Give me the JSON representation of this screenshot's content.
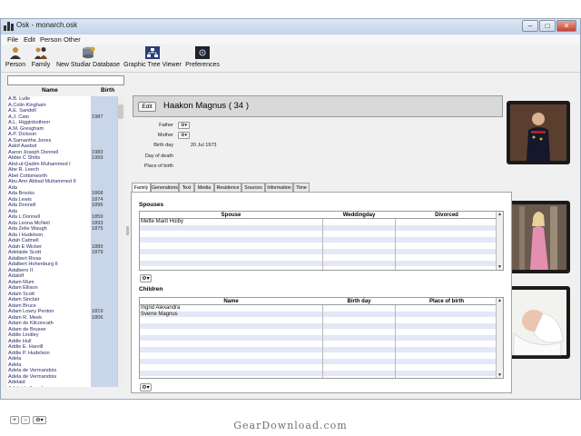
{
  "window": {
    "title": "Osk - monarch.osk"
  },
  "menu": [
    "File",
    "Edit",
    "Person",
    "Other"
  ],
  "toolbar": {
    "person": "Person",
    "family": "Family",
    "new_db": "New Studiar Database",
    "graphic_tree": "Graphic Tree Viewer",
    "preferences": "Preferences"
  },
  "person_list": {
    "search_placeholder": "",
    "col_name": "Name",
    "col_birth": "Birth",
    "rows": [
      {
        "name": "A.B. Lutle",
        "birth": ""
      },
      {
        "name": "A.Colin Kingham",
        "birth": ""
      },
      {
        "name": "A.E. Sandell",
        "birth": ""
      },
      {
        "name": "A.J. Cato",
        "birth": "1987"
      },
      {
        "name": "A.L. Higginbothem",
        "birth": ""
      },
      {
        "name": "A.M. Gresgham",
        "birth": ""
      },
      {
        "name": "A.P. Dickson",
        "birth": ""
      },
      {
        "name": "A.Samantha Jones",
        "birth": ""
      },
      {
        "name": "Aalof Aasbot",
        "birth": ""
      },
      {
        "name": "Aaron Joseph Donnell",
        "birth": "1983"
      },
      {
        "name": "Abbie C Shilts",
        "birth": "1959"
      },
      {
        "name": "Abd-ul-Qadim Muhammed I",
        "birth": ""
      },
      {
        "name": "Abe R. Leech",
        "birth": ""
      },
      {
        "name": "Abel Cottonworth",
        "birth": ""
      },
      {
        "name": "Abu Amr Abbad Muhammed II",
        "birth": ""
      },
      {
        "name": "Ada",
        "birth": ""
      },
      {
        "name": "Ada Brooks",
        "birth": "1868"
      },
      {
        "name": "Ada Lewis",
        "birth": "1874"
      },
      {
        "name": "Ada Donnell",
        "birth": "1896"
      },
      {
        "name": "Ada",
        "birth": ""
      },
      {
        "name": "Ada L Donnell",
        "birth": "1859"
      },
      {
        "name": "Ada Leona McNeil",
        "birth": "1893"
      },
      {
        "name": "Ada Zelie Waugh",
        "birth": "1875"
      },
      {
        "name": "Ada I Hudelson",
        "birth": ""
      },
      {
        "name": "Adah Catmell",
        "birth": ""
      },
      {
        "name": "Adah E Wicker",
        "birth": "1889"
      },
      {
        "name": "Adelaide Scott",
        "birth": "1879"
      },
      {
        "name": "Adalbert Rivas",
        "birth": ""
      },
      {
        "name": "Adalbert Hohenburg II",
        "birth": ""
      },
      {
        "name": "Adalbero II",
        "birth": ""
      },
      {
        "name": "Adalolf",
        "birth": ""
      },
      {
        "name": "Adam Mum",
        "birth": ""
      },
      {
        "name": "Adam Ellison",
        "birth": ""
      },
      {
        "name": "Adam Scott",
        "birth": ""
      },
      {
        "name": "Adam Sinclair",
        "birth": ""
      },
      {
        "name": "Adam Bruce",
        "birth": ""
      },
      {
        "name": "Adam Lowry Penton",
        "birth": "1819"
      },
      {
        "name": "Adam R. Meek",
        "birth": "1806"
      },
      {
        "name": "Adam de Kilconcath",
        "birth": ""
      },
      {
        "name": "Adam de Brusee",
        "birth": ""
      },
      {
        "name": "Addie Lindley",
        "birth": ""
      },
      {
        "name": "Addie Hull",
        "birth": ""
      },
      {
        "name": "Addie E. Harvill",
        "birth": ""
      },
      {
        "name": "Addie P. Hudelson",
        "birth": ""
      },
      {
        "name": "Adela",
        "birth": ""
      },
      {
        "name": "Adela",
        "birth": ""
      },
      {
        "name": "Adela de Vermandois",
        "birth": ""
      },
      {
        "name": "Adela de Vermandois",
        "birth": ""
      },
      {
        "name": "Adelaid",
        "birth": ""
      },
      {
        "name": "Adelaide Arpad",
        "birth": ""
      }
    ],
    "footer": {
      "add": "+",
      "remove": "−",
      "more": "⚙▾"
    }
  },
  "person": {
    "edit_label": "Edit",
    "name": "Haakon Magnus",
    "age": "( 34 )",
    "father_label": "Father",
    "mother_label": "Mother",
    "birthday_label": "Birth day",
    "birthday": "20 Jul 1973",
    "dayofdeath_label": "Day of death",
    "placeofbirth_label": "Place of birth",
    "dropdown": "⚙▾"
  },
  "tabs": [
    "Family",
    "Generations",
    "Text",
    "Media",
    "Residence",
    "Sources",
    "Information",
    "Time"
  ],
  "spouses": {
    "title": "Spouses",
    "columns": [
      "Spouse",
      "Weddingday",
      "Divorced"
    ],
    "rows": [
      {
        "spouse": "Mette Marit Hoiby",
        "weddingday": "",
        "divorced": ""
      }
    ]
  },
  "children": {
    "title": "Children",
    "columns": [
      "Name",
      "Birth day",
      "Place of birth"
    ],
    "rows": [
      {
        "name": "Ingrid Alexandra",
        "birthday": "",
        "place": ""
      },
      {
        "name": "Sverre Magnus",
        "birthday": "",
        "place": ""
      }
    ]
  },
  "watermark": "GearDownload.com",
  "colors": {
    "selection": "#c9d5e8",
    "stripe": "#e4e8f6",
    "header": "#d9d9d9"
  }
}
